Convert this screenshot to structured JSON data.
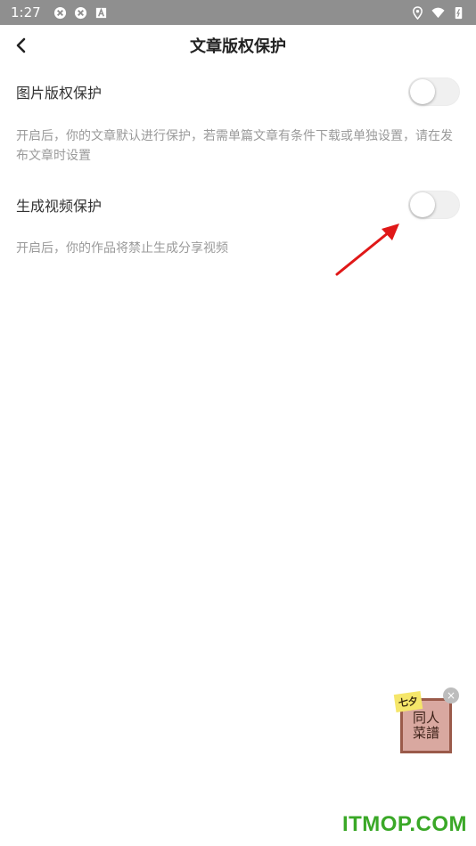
{
  "status_bar": {
    "time": "1:27",
    "left_icons": [
      "sync-icon",
      "sync-icon",
      "a-badge-icon"
    ],
    "right_icons": [
      "location-icon",
      "wifi-icon",
      "battery-icon"
    ]
  },
  "header": {
    "title": "文章版权保护",
    "back_icon": "chevron-left-icon"
  },
  "settings": [
    {
      "label": "图片版权保护",
      "enabled": false,
      "description": "开启后，你的文章默认进行保护，若需单篇文章有条件下载或单独设置，请在发布文章时设置"
    },
    {
      "label": "生成视频保护",
      "enabled": false,
      "description": "开启后，你的作品将禁止生成分享视频"
    }
  ],
  "float_ad": {
    "sticker": "七夕",
    "line1": "同人",
    "line2": "菜譜",
    "close_symbol": "×"
  },
  "watermark": "ITMOP.COM",
  "colors": {
    "status_bar": "#8f8f8f",
    "toggle_off": "#f0f0f0",
    "description_text": "#9a9a9a",
    "annotation_arrow": "#e01818",
    "watermark": "#3aa827"
  }
}
